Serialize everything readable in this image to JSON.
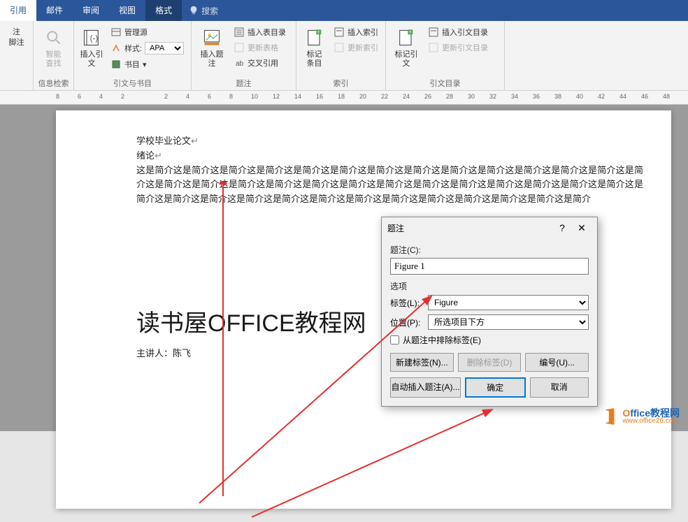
{
  "tabs": {
    "references": "引用",
    "mailings": "邮件",
    "review": "审阅",
    "view": "视图",
    "format": "格式"
  },
  "search": {
    "placeholder": "搜索"
  },
  "ribbon": {
    "insert_note": "注",
    "footnote": "脚注",
    "smart_lookup": "智能\n查找",
    "info_group": "信息检索",
    "insert_citation": "插入引文",
    "manage_sources": "管理源",
    "style_label": "样式:",
    "style_value": "APA",
    "bibliography": "书目",
    "citation_group": "引文与书目",
    "insert_caption": "插入题注",
    "insert_tof": "插入表目录",
    "update_table": "更新表格",
    "cross_ref": "交叉引用",
    "caption_group": "题注",
    "mark_entry": "标记\n条目",
    "insert_index": "插入索引",
    "update_index": "更新索引",
    "index_group": "索引",
    "mark_citation": "标记引文",
    "insert_toa": "插入引文目录",
    "update_toa": "更新引文目录",
    "toa_group": "引文目录"
  },
  "ruler": {
    "marks": [
      8,
      6,
      4,
      2,
      "",
      2,
      4,
      6,
      8,
      10,
      12,
      14,
      16,
      18,
      20,
      22,
      24,
      26,
      28,
      30,
      32,
      34,
      36,
      38,
      40,
      42,
      44,
      46,
      48
    ]
  },
  "doc": {
    "line1": "学校毕业论文",
    "line2": "绪论",
    "body": "这是简介这是简介这是简介这是简介这是简介这是简介这是简介这是简介这是简介这是简介这是简介这是简介这是简介这是简介这是简介这是简介这是简介这是简介这是简介这是简介这是简介这是简介这是简介这是简介这是简介这是简介这是简介这是简介这是简介这是简介这是简介这是简介这是简介这是简介这是简介这是简介这是简介这是简介这是简介这是简介",
    "logo": "读书屋OFFICE教程网",
    "presenter_label": "主讲人：",
    "presenter_name": "陈飞"
  },
  "dialog": {
    "title": "题注",
    "caption_label": "题注(C):",
    "caption_value": "Figure 1",
    "options_label": "选项",
    "label_label": "标签(L):",
    "label_value": "Figure",
    "position_label": "位置(P):",
    "position_value": "所选项目下方",
    "exclude_label": "从题注中排除标签(E)",
    "new_label": "新建标签(N)...",
    "delete_label": "删除标签(D)",
    "numbering": "编号(U)...",
    "auto_caption": "自动插入题注(A)...",
    "ok": "确定",
    "cancel": "取消"
  },
  "watermark": {
    "brand1": "O",
    "brand2": "ffice",
    "brand3": "教程网",
    "url": "www.office26.com"
  }
}
